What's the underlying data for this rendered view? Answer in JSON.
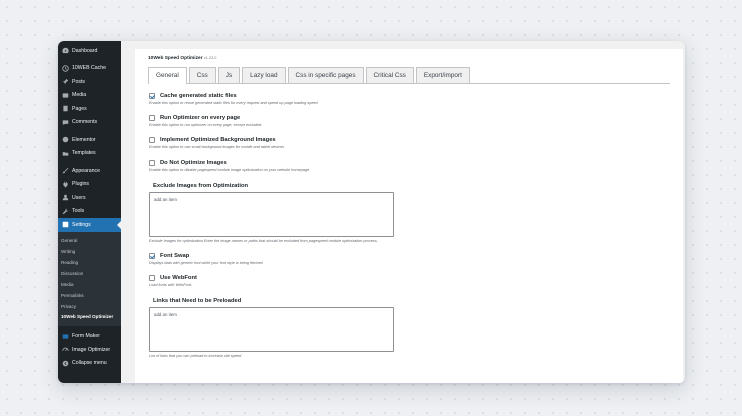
{
  "sidebar": {
    "items_top": [
      {
        "label": "Dashboard",
        "icon": "dashboard-icon"
      },
      {
        "label": "10WEB Cache",
        "icon": "cache-icon"
      },
      {
        "label": "Posts",
        "icon": "pin-icon"
      },
      {
        "label": "Media",
        "icon": "media-icon"
      },
      {
        "label": "Pages",
        "icon": "page-icon"
      },
      {
        "label": "Comments",
        "icon": "comment-icon"
      }
    ],
    "items_mid": [
      {
        "label": "Elementor",
        "icon": "elementor-icon"
      },
      {
        "label": "Templates",
        "icon": "folder-icon"
      }
    ],
    "items_admin": [
      {
        "label": "Appearance",
        "icon": "brush-icon"
      },
      {
        "label": "Plugins",
        "icon": "plugin-icon"
      },
      {
        "label": "Users",
        "icon": "user-icon"
      },
      {
        "label": "Tools",
        "icon": "wrench-icon"
      }
    ],
    "active": {
      "label": "Settings",
      "icon": "settings-icon"
    },
    "submenu": [
      "General",
      "Writing",
      "Reading",
      "Discussion",
      "Media",
      "Permalinks",
      "Privacy"
    ],
    "submenu_current": "10Web Speed Optimizer",
    "items_bottom": [
      {
        "label": "Form Maker",
        "icon": "form-icon"
      },
      {
        "label": "Image Optimizer",
        "icon": "gauge-icon"
      },
      {
        "label": "Collapse menu",
        "icon": "collapse-icon"
      }
    ]
  },
  "plugin": {
    "title": "10Web Speed Optimizer",
    "version": "v1.22.0"
  },
  "tabs": [
    "General",
    "Css",
    "Js",
    "Lazy load",
    "Css in specific pages",
    "Critical Css",
    "Export/import"
  ],
  "options": [
    {
      "label": "Cache generated static files",
      "checked": true,
      "desc": "Enable this option to reuse generated static files for every request and speed up page loading speed"
    },
    {
      "label": "Run Optimizer on every page",
      "checked": false,
      "desc": "Enable this option to run optimizer on every page, except excluded."
    },
    {
      "label": "Implement Optimized Background Images",
      "checked": false,
      "desc": "Enable this option to use small background images for mobile and tablet devices"
    },
    {
      "label": "Do Not Optimize Images",
      "checked": false,
      "desc": "Enable this option to disable pagespeed module image optimization on your website homepage."
    }
  ],
  "exclude_images": {
    "label": "Exclude Images from Optimization",
    "placeholder": "add an item",
    "desc": "Exclude Images for optimization Enter the image names or paths that should be excluded from pagespeed module optimization process."
  },
  "options2": [
    {
      "label": "Font Swap",
      "checked": true,
      "desc": "Displays data with generic font while your font style is being fetched."
    },
    {
      "label": "Use WebFont",
      "checked": false,
      "desc": "Load fonts with WebFont."
    }
  ],
  "preload_links": {
    "label": "Links that Need to be Preloaded",
    "placeholder": "add an item",
    "desc": "List of links that you can preload to increase site speed"
  }
}
